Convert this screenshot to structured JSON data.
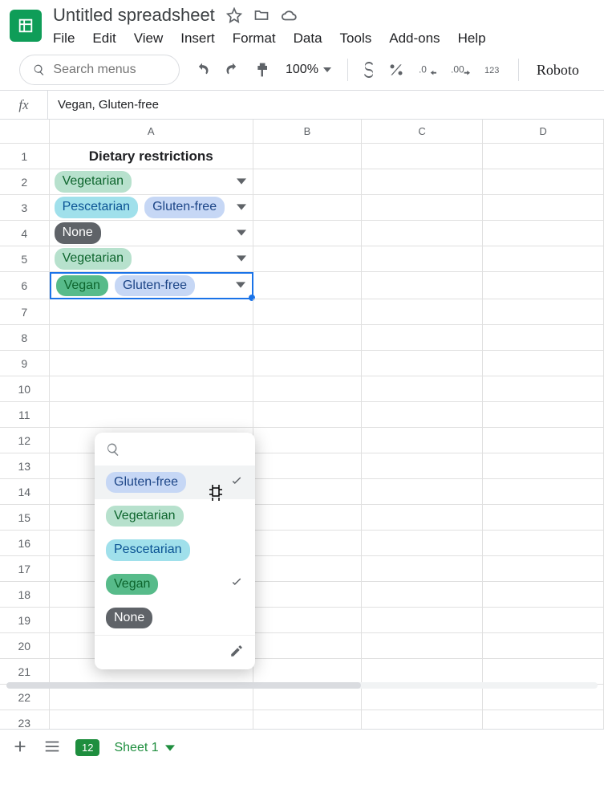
{
  "doc": {
    "title": "Untitled spreadsheet"
  },
  "menu": {
    "file": "File",
    "edit": "Edit",
    "view": "View",
    "insert": "Insert",
    "format": "Format",
    "data": "Data",
    "tools": "Tools",
    "addons": "Add-ons",
    "help": "Help"
  },
  "toolbar": {
    "search_placeholder": "Search menus",
    "zoom": "100%",
    "font": "Roboto"
  },
  "fx": {
    "label": "fx",
    "value": "Vegan, Gluten-free"
  },
  "cols": {
    "A": "A",
    "B": "B",
    "C": "C",
    "D": "D"
  },
  "header_cell": "Dietary restrictions",
  "cells": {
    "r2": [
      {
        "text": "Vegetarian",
        "cls": "c-veg"
      }
    ],
    "r3": [
      {
        "text": "Pescetarian",
        "cls": "c-pes"
      },
      {
        "text": "Gluten-free",
        "cls": "c-glu"
      }
    ],
    "r4": [
      {
        "text": "None",
        "cls": "c-non"
      }
    ],
    "r5": [
      {
        "text": "Vegetarian",
        "cls": "c-veg"
      }
    ],
    "r6": [
      {
        "text": "Vegan",
        "cls": "c-vgn"
      },
      {
        "text": "Gluten-free",
        "cls": "c-glu"
      }
    ]
  },
  "dropdown": {
    "items": [
      {
        "text": "Gluten-free",
        "cls": "c-glu",
        "hover": true,
        "checked": true
      },
      {
        "text": "Vegetarian",
        "cls": "c-veg"
      },
      {
        "text": "Pescetarian",
        "cls": "c-pes"
      },
      {
        "text": "Vegan",
        "cls": "c-vgn",
        "checked": true
      },
      {
        "text": "None",
        "cls": "c-non"
      }
    ]
  },
  "bottom": {
    "badge": "12",
    "sheet": "Sheet 1"
  }
}
